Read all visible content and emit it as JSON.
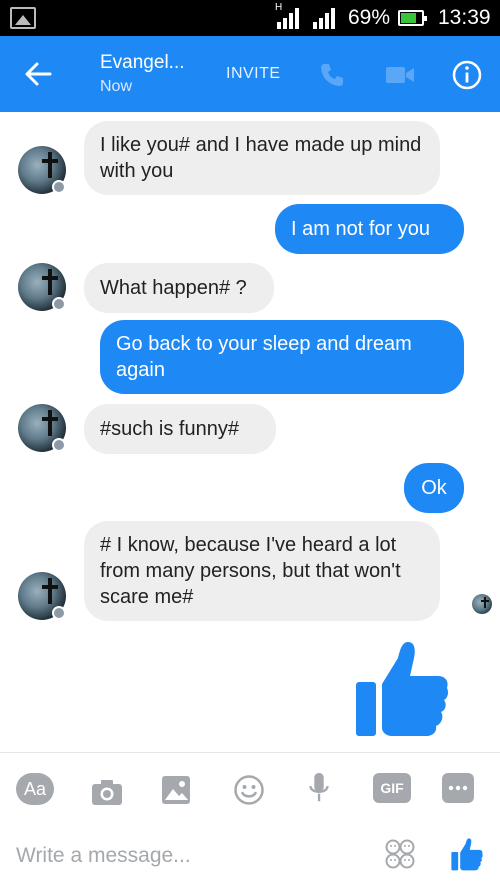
{
  "status_bar": {
    "network_type": "H",
    "battery_percent": "69%",
    "battery_level": 0.69,
    "time": "13:39"
  },
  "header": {
    "contact_name": "Evangel...",
    "presence": "Now",
    "invite_label": "INVITE",
    "icons": [
      "back-arrow-icon",
      "phone-icon",
      "video-camera-icon",
      "info-icon"
    ],
    "color": "#1e88f5"
  },
  "messages": [
    {
      "direction": "in",
      "text": "I like you# and I have made up mind with you"
    },
    {
      "direction": "out",
      "text": "I am not for you"
    },
    {
      "direction": "in",
      "text": "What happen# ?"
    },
    {
      "direction": "out",
      "text": "Go back to your sleep and dream again"
    },
    {
      "direction": "in",
      "text": "#such is funny#"
    },
    {
      "direction": "out",
      "text": "Ok"
    },
    {
      "direction": "in",
      "text": "# I know, because I've heard a lot from many persons, but that won't scare me#"
    },
    {
      "direction": "out",
      "type": "like",
      "icon": "thumbs-up-icon"
    }
  ],
  "toolbar": {
    "aa_label": "Aa",
    "gif_label": "GIF",
    "icons": [
      "camera-icon",
      "image-icon",
      "emoji-icon",
      "microphone-icon",
      "more-icon"
    ]
  },
  "composer": {
    "placeholder": "Write a message...",
    "value": "",
    "icons": [
      "stickers-icon",
      "thumbs-up-icon"
    ]
  },
  "colors": {
    "brand_blue": "#1e88f5",
    "incoming_bubble": "#eeeeee",
    "toolbar_icon_gray": "#a5a9ad"
  }
}
